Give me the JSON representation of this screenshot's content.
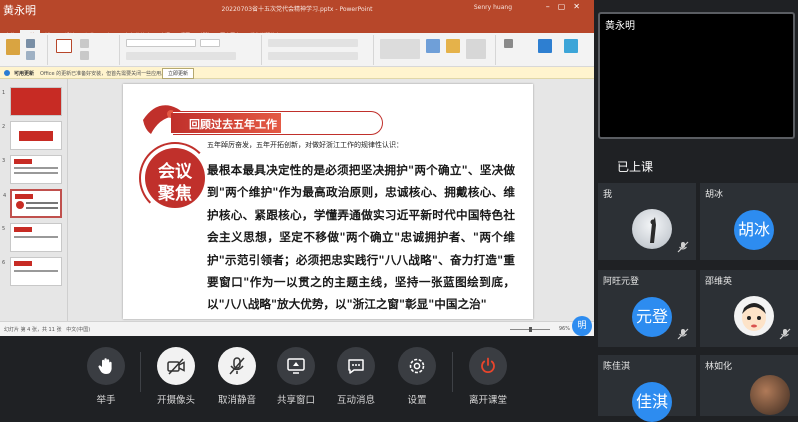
{
  "shared_screen": {
    "presenter_label": "黄永明",
    "ppt": {
      "title": "20220703省十五次党代会精神学习.pptx - PowerPoint",
      "user": "Senry huang",
      "tabs": [
        "文件",
        "开始",
        "插入",
        "设计",
        "切换",
        "动画",
        "幻灯片放映",
        "审阅",
        "视图",
        "帮助",
        "百度网盘",
        "操作说明搜索"
      ],
      "active_tab": "开始",
      "message_bar": {
        "label": "可用更新",
        "text": "Office 的更新已准备好安装，但首先需要关闭一些应用。",
        "button": "立即更新"
      },
      "slide_numbers": [
        "1",
        "2",
        "3",
        "4",
        "5",
        "6"
      ],
      "selected_slide": "4",
      "slide": {
        "title": "回顾过去五年工作",
        "subtitle": "五年踔厉奋发，五年开拓创新，对做好浙江工作的规律性认识：",
        "badge_line1": "会议",
        "badge_line2": "聚焦",
        "body": "最根本最具决定性的是必须把坚决拥护\"两个确立\"、坚决做到\"两个维护\"作为最高政治原则，忠诚核心、拥戴核心、维护核心、紧跟核心，学懂弄通做实习近平新时代中国特色社会主义思想，坚定不移做\"两个确立\"忠诚拥护者、\"两个维护\"示范引领者；必须把忠实践行\"八八战略\"、奋力打造\"重要窗口\"作为一以贯之的主题主线，坚持一张蓝图绘到底，以\"八八战略\"放大优势，以\"浙江之窗\"彰显\"中国之治\""
      },
      "status_left": "幻灯片 第 4 张，共 11 张",
      "status_lang": "中文(中国)",
      "status_zoom": "96%"
    },
    "bottom_avatar_char": "明"
  },
  "teacher": {
    "name": "黄永明"
  },
  "class_status": "已上课",
  "students": [
    {
      "name": "我",
      "avatar": "",
      "kind": "photo"
    },
    {
      "name": "胡冰",
      "avatar": "胡冰",
      "kind": "text"
    },
    {
      "name": "阿旺元登",
      "avatar": "元登",
      "kind": "text"
    },
    {
      "name": "邵维英",
      "avatar": "",
      "kind": "cartoon"
    },
    {
      "name": "陈佳淇",
      "avatar": "佳淇",
      "kind": "text"
    },
    {
      "name": "林如化",
      "avatar": "",
      "kind": "photo"
    }
  ],
  "toolbar": {
    "raise_hand": "举手",
    "open_camera": "开摄像头",
    "unmute": "取消静音",
    "share_window": "共享窗口",
    "interact": "互动消息",
    "settings": "设置",
    "leave": "离开课堂"
  },
  "colors": {
    "ppt_brand": "#b7472a",
    "slide_red": "#c0302b",
    "avatar_blue": "#2d8cf0",
    "leave_red": "#e8452c"
  }
}
